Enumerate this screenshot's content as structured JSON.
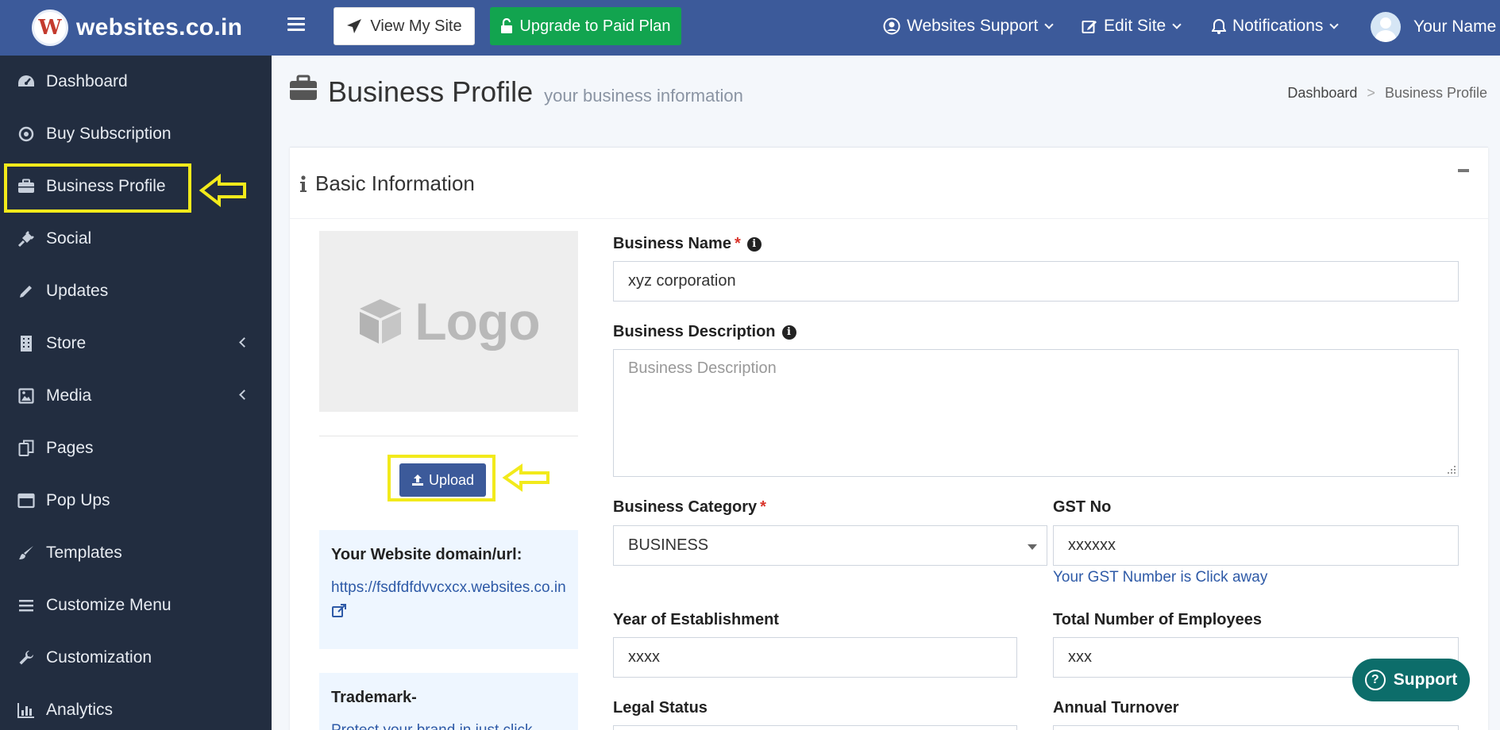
{
  "topbar": {
    "brand_letter": "W",
    "brand_name": "websites.co.in",
    "view_site_label": "View My Site",
    "upgrade_label": "Upgrade to Paid Plan",
    "support_menu": "Websites Support",
    "edit_menu": "Edit Site",
    "notifications_menu": "Notifications",
    "user_name": "Your Name",
    "colors": {
      "bar": "#3c5a9a",
      "upgrade": "#12a44f"
    }
  },
  "sidebar": {
    "items": [
      {
        "label": "Dashboard",
        "icon": "dashboard-icon"
      },
      {
        "label": "Buy Subscription",
        "icon": "target-icon"
      },
      {
        "label": "Business Profile",
        "icon": "briefcase-icon"
      },
      {
        "label": "Social",
        "icon": "plug-icon"
      },
      {
        "label": "Updates",
        "icon": "pencil-icon"
      },
      {
        "label": "Store",
        "icon": "building-icon"
      },
      {
        "label": "Media",
        "icon": "image-icon"
      },
      {
        "label": "Pages",
        "icon": "copy-icon"
      },
      {
        "label": "Pop Ups",
        "icon": "window-icon"
      },
      {
        "label": "Templates",
        "icon": "brush-icon"
      },
      {
        "label": "Customize Menu",
        "icon": "bars-icon"
      },
      {
        "label": "Customization",
        "icon": "wrench-icon"
      },
      {
        "label": "Analytics",
        "icon": "bar-chart-icon"
      }
    ]
  },
  "page": {
    "title": "Business Profile",
    "subtitle": "your business information",
    "breadcrumb": {
      "home": "Dashboard",
      "sep": ">",
      "current": "Business Profile"
    }
  },
  "card": {
    "title": "Basic Information",
    "logo_placeholder": "Logo",
    "upload_label": "Upload",
    "domain": {
      "title": "Your Website domain/url:",
      "url": "https://fsdfdfdvvcxcx.websites.co.in"
    },
    "trademark": {
      "title": "Trademark-",
      "text": "Protect your brand in just click"
    }
  },
  "form": {
    "business_name": {
      "label": "Business Name",
      "required": "*",
      "value": "xyz corporation"
    },
    "business_description": {
      "label": "Business Description",
      "placeholder": "Business Description"
    },
    "business_category": {
      "label": "Business Category",
      "required": "*",
      "value": "BUSINESS"
    },
    "gst_no": {
      "label": "GST No",
      "value": "xxxxxx",
      "hint": "Your GST Number is Click away"
    },
    "year": {
      "label": "Year of Establishment",
      "value": "xxxx"
    },
    "employees": {
      "label": "Total Number of Employees",
      "value": "xxx"
    },
    "legal_status": {
      "label": "Legal Status"
    },
    "turnover": {
      "label": "Annual Turnover"
    }
  },
  "support_button": {
    "label": "Support",
    "color": "#0c6d6a"
  }
}
